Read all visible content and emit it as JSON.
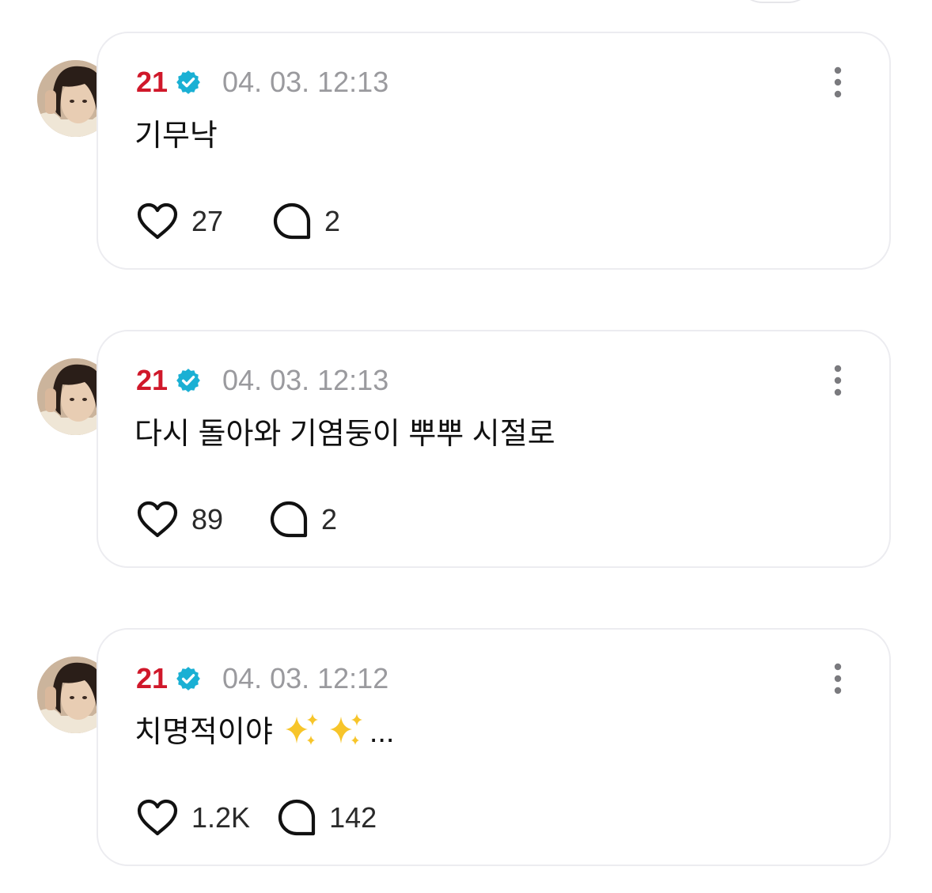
{
  "colors": {
    "username": "#d0182a",
    "verified_badge": "#1ab0d4",
    "timestamp": "#9a9a9e",
    "card_border": "#ececf0"
  },
  "icons": {
    "verified": "verified-badge-icon",
    "more": "more-vertical-icon",
    "like": "heart-icon",
    "comment": "comment-bubble-icon",
    "emoji": "sparkles-emoji"
  },
  "posts": [
    {
      "username": "21",
      "timestamp": "04. 03. 12:13",
      "text": "기무낙",
      "likes": "27",
      "comments": "2"
    },
    {
      "username": "21",
      "timestamp": "04. 03. 12:13",
      "text": "다시 돌아와 기염둥이 뿌뿌 시절로",
      "likes": "89",
      "comments": "2"
    },
    {
      "username": "21",
      "timestamp": "04. 03. 12:12",
      "text": "치명적이야",
      "text_suffix": "...",
      "likes": "1.2K",
      "comments": "142"
    }
  ]
}
